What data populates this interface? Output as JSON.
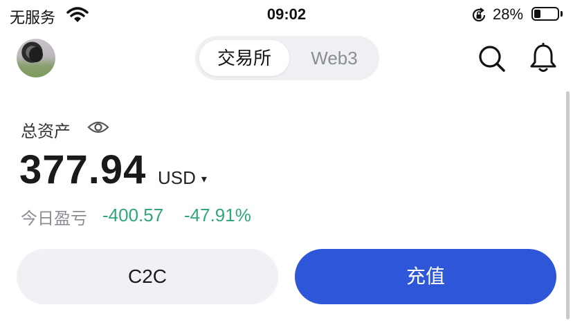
{
  "status_bar": {
    "carrier": "无服务",
    "time": "09:02",
    "battery_percent": "28%",
    "battery_level": 0.28,
    "icons": [
      "wifi-icon",
      "orientation-lock-icon",
      "battery-icon"
    ]
  },
  "header": {
    "tabs": [
      {
        "label": "交易所",
        "active": true
      },
      {
        "label": "Web3",
        "active": false
      }
    ],
    "icons": [
      "avatar",
      "search-icon",
      "bell-icon"
    ]
  },
  "assets": {
    "label": "总资产",
    "balance": "377.94",
    "currency": "USD",
    "caret": "▾",
    "pnl_label": "今日盈亏",
    "pnl_value": "-400.57",
    "pnl_percent": "-47.91%",
    "pnl_color": "#2fa77a"
  },
  "actions": {
    "c2c_label": "C2C",
    "deposit_label": "充值",
    "deposit_color": "#2e56d9"
  }
}
